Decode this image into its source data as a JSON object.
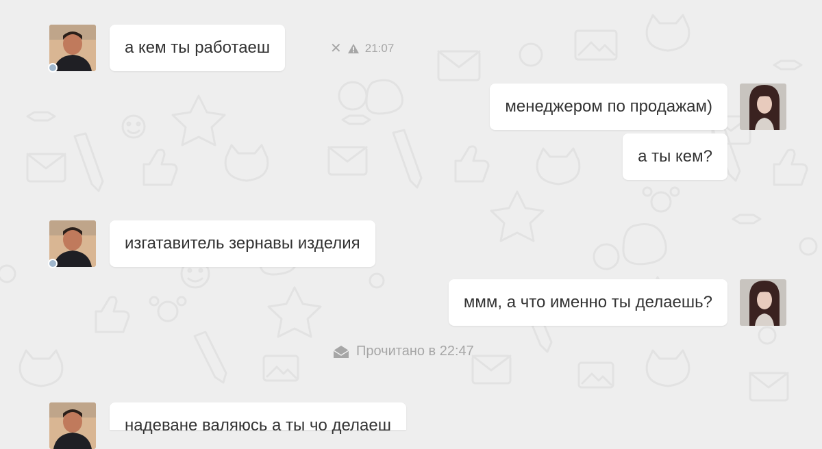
{
  "conversation": {
    "messages": [
      {
        "sender": "male",
        "text": "а кем ты работаеш"
      },
      {
        "sender": "female",
        "text": "менеджером по продажам)"
      },
      {
        "sender": "female",
        "text": "а ты кем?"
      },
      {
        "sender": "male",
        "text": "изгатавитель зернавы изделия"
      },
      {
        "sender": "female",
        "text": "ммм, а что именно ты делаешь?"
      },
      {
        "sender": "male",
        "text": "надеване валяюсь а ты чо делаеш"
      }
    ],
    "first_message_meta": {
      "time": "21:07",
      "icons": [
        "close-icon",
        "warning-icon"
      ]
    },
    "read_status": {
      "text": "Прочитано в 22:47",
      "icon": "envelope-open-icon"
    }
  },
  "colors": {
    "background": "#eeeeee",
    "bubble": "#ffffff",
    "text": "#333333",
    "meta_text": "#a6a6a6",
    "online_dot": "#9fb6cc"
  }
}
